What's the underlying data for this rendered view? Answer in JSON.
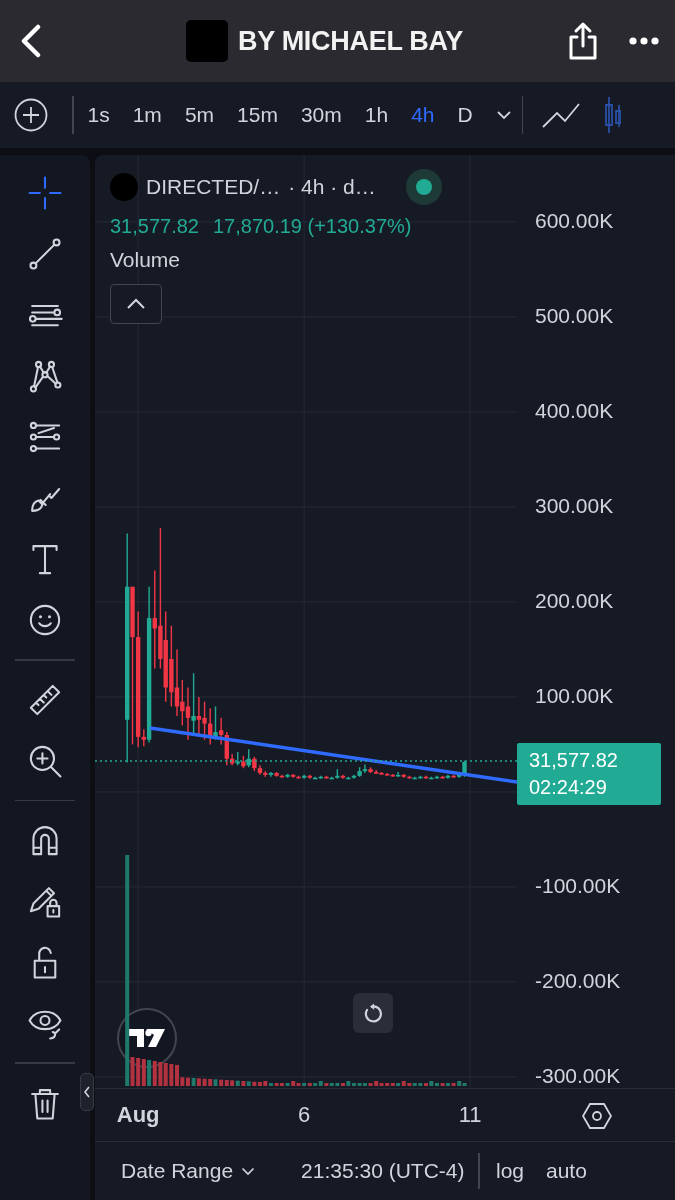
{
  "header": {
    "title": "BY MICHAEL BAY"
  },
  "intervals": [
    {
      "label": "1s",
      "selected": false
    },
    {
      "label": "1m",
      "selected": false
    },
    {
      "label": "5m",
      "selected": false
    },
    {
      "label": "15m",
      "selected": false
    },
    {
      "label": "30m",
      "selected": false
    },
    {
      "label": "1h",
      "selected": false
    },
    {
      "label": "4h",
      "selected": true
    },
    {
      "label": "D",
      "selected": false
    }
  ],
  "tool_groups": [
    [
      {
        "kind": "crosshair",
        "selected": true
      },
      {
        "kind": "trend",
        "selected": false
      },
      {
        "kind": "lines",
        "selected": false
      },
      {
        "kind": "pattern",
        "selected": false
      },
      {
        "kind": "fib",
        "selected": false
      },
      {
        "kind": "brush",
        "selected": false
      },
      {
        "kind": "text",
        "selected": false
      },
      {
        "kind": "smiley",
        "selected": false
      }
    ],
    [
      {
        "kind": "ruler",
        "selected": false
      },
      {
        "kind": "zoom",
        "selected": false
      }
    ],
    [
      {
        "kind": "magnet",
        "selected": false
      },
      {
        "kind": "pencil-lock",
        "selected": false
      },
      {
        "kind": "lock",
        "selected": false
      },
      {
        "kind": "eye",
        "selected": false
      }
    ],
    [
      {
        "kind": "trash",
        "selected": false
      }
    ]
  ],
  "legend": {
    "symbol": "DIRECTED/…",
    "interval": "· 4h · d…",
    "last": "31,577.82",
    "change": "17,870.19 (+130.37%)",
    "indicator": "Volume",
    "live": true
  },
  "chart_data": {
    "type": "candlestick",
    "x": [
      0.67,
      0.83,
      1,
      1.17,
      1.33,
      1.5,
      1.67,
      1.83,
      2,
      2.17,
      2.33,
      2.5,
      2.67,
      2.83,
      3,
      3.17,
      3.33,
      3.5,
      3.67,
      3.83,
      4,
      4.17,
      4.33,
      4.5,
      4.67,
      4.83,
      5,
      5.17,
      5.33,
      5.5,
      5.67,
      5.83,
      6,
      6.17,
      6.33,
      6.5,
      6.67,
      6.83,
      7,
      7.17,
      7.33,
      7.5,
      7.67,
      7.83,
      8,
      8.17,
      8.33,
      8.5,
      8.67,
      8.83,
      9,
      9.17,
      9.33,
      9.5,
      9.67,
      9.83,
      10,
      10.17,
      10.33,
      10.5,
      10.67,
      10.83
    ],
    "ohlc": [
      [
        76,
        272,
        31,
        216
      ],
      [
        216,
        216,
        50,
        163
      ],
      [
        163,
        190,
        47,
        58
      ],
      [
        58,
        66,
        48,
        55
      ],
      [
        55,
        216,
        52,
        183
      ],
      [
        183,
        233,
        130,
        172
      ],
      [
        175,
        278,
        130,
        140
      ],
      [
        160,
        190,
        95,
        110
      ],
      [
        140,
        175,
        90,
        105
      ],
      [
        110,
        150,
        80,
        90
      ],
      [
        95,
        118,
        70,
        85
      ],
      [
        90,
        110,
        55,
        78
      ],
      [
        75,
        125,
        60,
        80
      ],
      [
        80,
        100,
        60,
        76
      ],
      [
        78,
        95,
        55,
        72
      ],
      [
        72,
        88,
        50,
        58
      ],
      [
        58,
        90,
        55,
        63
      ],
      [
        65,
        78,
        50,
        60
      ],
      [
        60,
        63,
        28,
        35
      ],
      [
        35,
        40,
        28,
        30
      ],
      [
        30,
        42,
        28,
        32
      ],
      [
        32,
        38,
        25,
        27
      ],
      [
        28,
        45,
        26,
        35
      ],
      [
        35,
        37,
        22,
        25
      ],
      [
        25,
        28,
        18,
        20
      ],
      [
        20,
        22,
        16,
        18
      ],
      [
        18,
        21,
        16,
        20
      ],
      [
        20,
        21,
        16,
        17
      ],
      [
        17,
        18,
        15,
        16
      ],
      [
        16,
        19,
        15,
        18
      ],
      [
        18,
        19,
        15,
        16
      ],
      [
        16,
        17,
        14,
        15
      ],
      [
        15,
        18,
        14,
        17
      ],
      [
        17,
        18,
        14,
        15
      ],
      [
        15,
        16,
        14,
        15
      ],
      [
        15,
        17,
        14,
        16
      ],
      [
        16,
        17,
        14,
        15
      ],
      [
        15,
        16,
        14,
        15
      ],
      [
        15,
        24,
        14,
        17
      ],
      [
        17,
        18,
        14,
        15
      ],
      [
        15,
        16,
        14,
        15
      ],
      [
        15,
        18,
        14,
        17
      ],
      [
        17,
        26,
        16,
        22
      ],
      [
        22,
        29,
        20,
        24
      ],
      [
        24,
        26,
        20,
        21
      ],
      [
        21,
        23,
        19,
        20
      ],
      [
        20,
        21,
        18,
        19
      ],
      [
        19,
        20,
        17,
        18
      ],
      [
        18,
        19,
        16,
        17
      ],
      [
        17,
        21,
        16,
        18
      ],
      [
        18,
        19,
        15,
        16
      ],
      [
        16,
        17,
        14,
        15
      ],
      [
        15,
        16,
        14,
        15
      ],
      [
        15,
        17,
        14,
        16
      ],
      [
        16,
        17,
        14,
        15
      ],
      [
        15,
        16,
        14,
        15
      ],
      [
        15,
        17,
        14,
        16
      ],
      [
        16,
        17,
        14,
        15
      ],
      [
        15,
        18,
        14,
        17
      ],
      [
        17,
        18,
        15,
        16
      ],
      [
        16,
        19,
        15,
        18
      ],
      [
        18,
        33,
        16,
        31.58
      ]
    ],
    "grid": true,
    "xlim": [
      -0.3,
      17.17
    ],
    "ylim": [
      -311.6,
      670.5
    ],
    "xticks": [
      {
        "value": 1,
        "label": "Aug"
      },
      {
        "value": 6,
        "label": "6"
      },
      {
        "value": 11,
        "label": "11"
      }
    ],
    "yticks": [
      {
        "value": 600,
        "label": "600.00K"
      },
      {
        "value": 500,
        "label": "500.00K"
      },
      {
        "value": 400,
        "label": "400.00K"
      },
      {
        "value": 300,
        "label": "300.00K"
      },
      {
        "value": 200,
        "label": "200.00K"
      },
      {
        "value": 100,
        "label": "100.00K"
      },
      {
        "value": -100,
        "label": "-100.00K"
      },
      {
        "value": -200,
        "label": "-200.00K"
      },
      {
        "value": -300,
        "label": "-300.00K"
      }
    ]
  },
  "price_tag": {
    "price": "31,577.82",
    "countdown": "02:24:29"
  },
  "bottom_bar": {
    "date_range": "Date Range",
    "time": "21:35:30 (UTC-4)",
    "log": "log",
    "auto": "auto"
  }
}
